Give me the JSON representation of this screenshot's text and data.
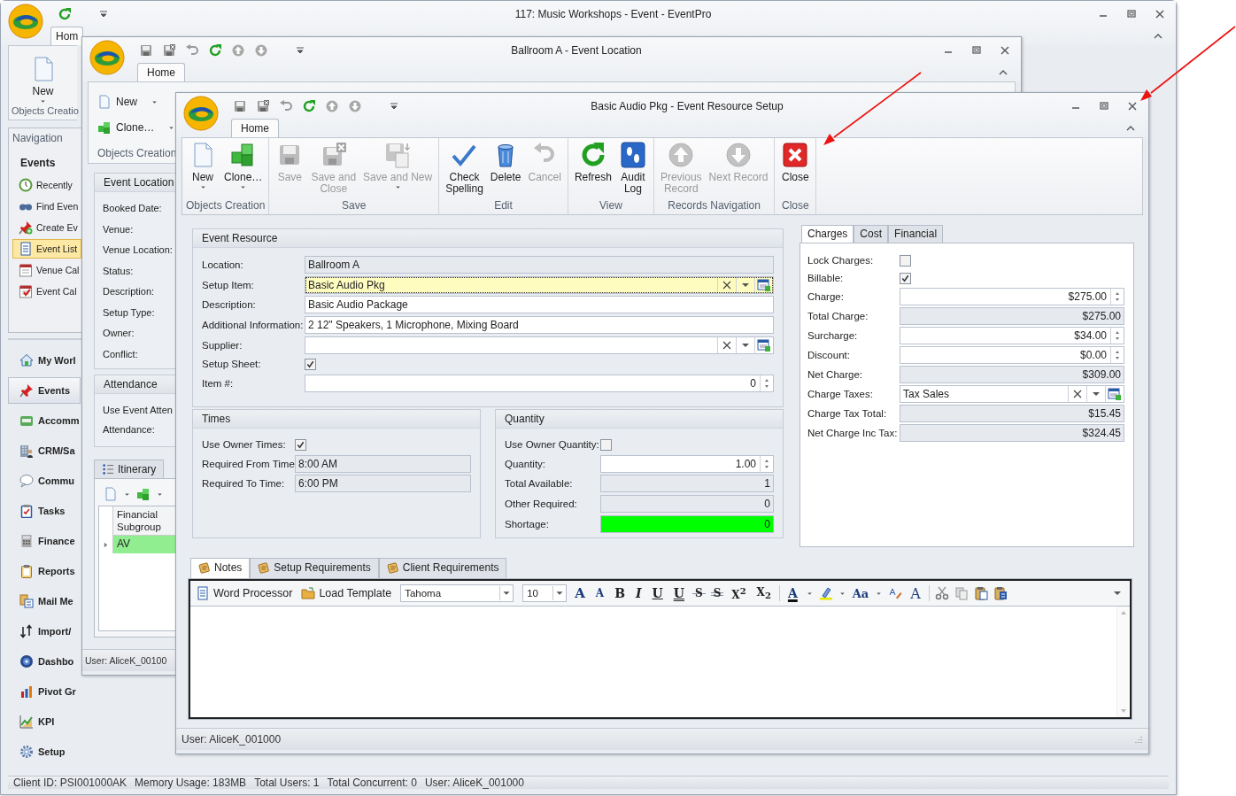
{
  "main_window": {
    "title": "117: Music Workshops - Event - EventPro",
    "tabs": [
      {
        "label": "Hom",
        "selected": true
      }
    ],
    "ribbon": {
      "button": "New",
      "group": "Objects Creatio"
    },
    "navigation": {
      "title": "Navigation",
      "heading": "Events",
      "items": [
        {
          "label": "Recently",
          "selected": false
        },
        {
          "label": "Find Even",
          "selected": false
        },
        {
          "label": "Create Ev",
          "selected": false
        },
        {
          "label": "Event List",
          "selected": true
        },
        {
          "label": "Venue Cal",
          "selected": false
        },
        {
          "label": "Event Cal",
          "selected": false
        }
      ]
    },
    "modules": [
      {
        "label": "My Worl",
        "selected": false
      },
      {
        "label": "Events",
        "selected": true
      },
      {
        "label": "Accomm",
        "selected": false
      },
      {
        "label": "CRM/Sa",
        "selected": false
      },
      {
        "label": "Commu",
        "selected": false
      },
      {
        "label": "Tasks",
        "selected": false
      },
      {
        "label": "Finance",
        "selected": false
      },
      {
        "label": "Reports",
        "selected": false
      },
      {
        "label": "Mail Me",
        "selected": false
      },
      {
        "label": "Import/",
        "selected": false
      },
      {
        "label": "Dashbo",
        "selected": false
      },
      {
        "label": "Pivot Gr",
        "selected": false
      },
      {
        "label": "KPI",
        "selected": false
      },
      {
        "label": "Setup",
        "selected": false
      }
    ],
    "status_bar": [
      "Client ID: PSI001000AK",
      "Memory Usage: 183MB",
      "Total Users: 1",
      "Total Concurrent: 0",
      "User: AliceK_001000"
    ]
  },
  "location_window": {
    "title": "Ballroom A - Event Location",
    "tabs": [
      {
        "label": "Home",
        "selected": true
      }
    ],
    "ribbon_buttons": [
      "New",
      "Clone…"
    ],
    "ribbon_group": "Objects Creation",
    "event_location": {
      "title": "Event Location",
      "labels": [
        "Booked Date:",
        "Venue:",
        "Venue Location:",
        "Status:",
        "Description:",
        "Setup Type:",
        "Owner:",
        "Conflict:"
      ]
    },
    "attendance": {
      "title": "Attendance",
      "labels": [
        "Use Event Atten",
        "Attendance:"
      ]
    },
    "lower_tabs": [
      {
        "label": "Itinerary",
        "selected": false
      }
    ],
    "grid": {
      "column": "Financial Subgroup",
      "rows": [
        {
          "value": "AV",
          "selected": true
        }
      ]
    },
    "status_bar": "User: AliceK_00100"
  },
  "resource_window": {
    "title": "Basic Audio Pkg - Event Resource Setup",
    "tabs": [
      {
        "label": "Home",
        "selected": true
      }
    ],
    "ribbon": [
      {
        "label": "Objects Creation",
        "buttons": [
          {
            "label": "New",
            "disabled": false,
            "dropdown": true
          },
          {
            "label": "Clone…",
            "disabled": false,
            "dropdown": true
          }
        ]
      },
      {
        "label": "Save",
        "buttons": [
          {
            "label": "Save",
            "disabled": true,
            "dropdown": false
          },
          {
            "label": "Save and\nClose",
            "disabled": true,
            "dropdown": false
          },
          {
            "label": "Save and New",
            "disabled": true,
            "dropdown": true
          }
        ]
      },
      {
        "label": "Edit",
        "buttons": [
          {
            "label": "Check\nSpelling",
            "disabled": false,
            "dropdown": false
          },
          {
            "label": "Delete",
            "disabled": false,
            "dropdown": false
          },
          {
            "label": "Cancel",
            "disabled": true,
            "dropdown": false
          }
        ]
      },
      {
        "label": "View",
        "buttons": [
          {
            "label": "Refresh",
            "disabled": false,
            "dropdown": false
          },
          {
            "label": "Audit\nLog",
            "disabled": false,
            "dropdown": false
          }
        ]
      },
      {
        "label": "Records Navigation",
        "buttons": [
          {
            "label": "Previous\nRecord",
            "disabled": true,
            "dropdown": false
          },
          {
            "label": "Next Record",
            "disabled": true,
            "dropdown": false
          }
        ]
      },
      {
        "label": "Close",
        "buttons": [
          {
            "label": "Close",
            "disabled": false,
            "dropdown": false
          }
        ]
      }
    ],
    "event_resource": {
      "title": "Event Resource",
      "fields": [
        {
          "label": "Location:",
          "kind": "readonly",
          "value": "Ballroom A"
        },
        {
          "label": "Setup Item:",
          "kind": "lookup",
          "value": "Basic Audio Pkg",
          "focused": true
        },
        {
          "label": "Description:",
          "kind": "text",
          "value": "Basic Audio Package"
        },
        {
          "label": "Additional Information:",
          "kind": "text",
          "value": "2 12\" Speakers, 1 Microphone, Mixing Board"
        },
        {
          "label": "Supplier:",
          "kind": "lookup"
        },
        {
          "label": "Setup Sheet:",
          "kind": "checkbox",
          "checked": true
        },
        {
          "label": "Item #:",
          "kind": "spin",
          "value": "0"
        }
      ]
    },
    "times": {
      "title": "Times",
      "fields": [
        {
          "label": "Use Owner Times:",
          "kind": "checkbox",
          "checked": true
        },
        {
          "label": "Required From Time:",
          "kind": "readonly",
          "value": "8:00 AM"
        },
        {
          "label": "Required To Time:",
          "kind": "readonly",
          "value": "6:00 PM"
        }
      ]
    },
    "quantity": {
      "title": "Quantity",
      "fields": [
        {
          "label": "Use Owner Quantity:",
          "kind": "checkbox",
          "checked": false
        },
        {
          "label": "Quantity:",
          "kind": "spin",
          "value": "1.00"
        },
        {
          "label": "Total Available:",
          "kind": "number",
          "value": "1"
        },
        {
          "label": "Other Required:",
          "kind": "number",
          "value": "0"
        },
        {
          "label": "Shortage:",
          "kind": "number",
          "value": "0",
          "color": "#00ff00"
        }
      ]
    },
    "charges_tabs": [
      {
        "label": "Charges",
        "selected": true
      },
      {
        "label": "Cost",
        "selected": false
      },
      {
        "label": "Financial",
        "selected": false
      }
    ],
    "charges": [
      {
        "label": "Lock Charges:",
        "kind": "checkbox",
        "checked": false
      },
      {
        "label": "Billable:",
        "kind": "checkbox",
        "checked": true
      },
      {
        "label": "Charge:",
        "kind": "spin",
        "value": "$275.00"
      },
      {
        "label": "Total Charge:",
        "kind": "number",
        "value": "$275.00"
      },
      {
        "label": "Surcharge:",
        "kind": "spin",
        "value": "$34.00"
      },
      {
        "label": "Discount:",
        "kind": "spin",
        "value": "$0.00"
      },
      {
        "label": "Net Charge:",
        "kind": "number",
        "value": "$309.00"
      },
      {
        "label": "Charge Taxes:",
        "kind": "lookup",
        "value": "Tax Sales"
      },
      {
        "label": "Charge Tax Total:",
        "kind": "number",
        "value": "$15.45"
      },
      {
        "label": "Net Charge Inc Tax:",
        "kind": "number",
        "value": "$324.45"
      }
    ],
    "notes_tabs": [
      {
        "label": "Notes",
        "selected": true
      },
      {
        "label": "Setup Requirements",
        "selected": false
      },
      {
        "label": "Client Requirements",
        "selected": false
      }
    ],
    "editor": {
      "buttons": [
        "Word Processor",
        "Load Template"
      ],
      "font": "Tahoma",
      "size": "10",
      "format_buttons": [
        {
          "label": "A",
          "kind": "grow"
        },
        {
          "label": "A",
          "kind": "shrink"
        },
        {
          "label": "B",
          "kind": "bold"
        },
        {
          "label": "I",
          "kind": "italic"
        },
        {
          "label": "U",
          "kind": "underline"
        },
        {
          "label": "U",
          "kind": "double-underline"
        },
        {
          "label": "S",
          "kind": "strike"
        },
        {
          "label": "S",
          "kind": "double-strike"
        },
        {
          "label": "X$^{2}$",
          "kind": "superscript"
        },
        {
          "label": "X$_{2}$",
          "kind": "subscript"
        },
        {
          "label": "A",
          "kind": "font-color"
        },
        {
          "label": "Aa",
          "kind": "case"
        },
        {
          "label": "A",
          "kind": "font"
        }
      ]
    },
    "status_bar": "User: AliceK_001000"
  }
}
